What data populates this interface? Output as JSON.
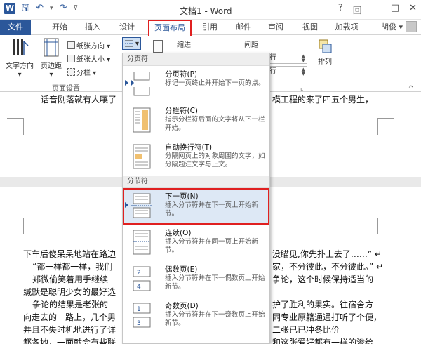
{
  "window": {
    "title": "文档1 - Word",
    "help": "?",
    "ribbon_opts": "回",
    "minimize": "—",
    "restore": "□",
    "close": "✕"
  },
  "qat": {
    "save": "🖫",
    "undo": "↶",
    "undo_more": "▾",
    "redo": "↷",
    "customize": "⊽"
  },
  "tabs": [
    "开始",
    "插入",
    "设计",
    "页面布局",
    "引用",
    "邮件",
    "审阅",
    "视图",
    "加载项"
  ],
  "file_tab": "文件",
  "user": "胡俊 ▾",
  "ribbon": {
    "text_direction": "文字方向",
    "text_direction_arrow": "▾",
    "margins": "页边距",
    "margins_arrow": "▾",
    "orientation": "纸张方向 ▾",
    "size": "纸张大小 ▾",
    "columns": "分栏 ▾",
    "breaks_arrow": "▾",
    "indent": "缩进",
    "spacing": "间距",
    "spin1": "行",
    "spin2": "行",
    "arrange": "排列",
    "group_label": "页面设置",
    "launcher": "⌞",
    "collapse": "^"
  },
  "document": {
    "top_line_left": "话音刚落就有人嚷了",
    "top_line_right": "模工程的来了四五个男生，",
    "lines_left": [
      "下车后傻呆呆地站在路边",
      "“都一样都一样，我们",
      "郑微偷笑着用手继续",
      "缄默是聪明少女的最好选",
      "争论的结果是老张的",
      "向走去的一路上，几个男",
      "并且不失时机地进行了详",
      "都各地，一面就会有些联"
    ],
    "lines_right": [
      "没瞄见,你先扑上去了……” ↵",
      "家，不分彼此，不分彼此。” ↵",
      "争论，这个时候保持适当的",
      "",
      "护了胜利的果实。往宿舍方",
      "同专业原籍通通打听了个便，",
      "二张已已冲冬比价",
      "和这张爱好都有一样的渗给"
    ]
  },
  "menu": {
    "sections": [
      "分页符",
      "分节符"
    ],
    "items": [
      {
        "title": "分页符(P)",
        "desc": "标记一页终止并开始下一页的点。"
      },
      {
        "title": "分栏符(C)",
        "desc": "指示分栏符后面的文字将从下一栏开始。"
      },
      {
        "title": "自动换行符(T)",
        "desc": "分隔网页上的对象周围的文字，如分隔题注文字与正文。"
      },
      {
        "title": "下一页(N)",
        "desc": "插入分节符并在下一页上开始新节。"
      },
      {
        "title": "连续(O)",
        "desc": "插入分节符并在同一页上开始新节。"
      },
      {
        "title": "偶数页(E)",
        "desc": "插入分节符并在下一偶数页上开始新节。"
      },
      {
        "title": "奇数页(D)",
        "desc": "插入分节符并在下一奇数页上开始新节。"
      }
    ]
  },
  "colors": {
    "accent": "#2b579a",
    "highlight": "#e02020"
  }
}
